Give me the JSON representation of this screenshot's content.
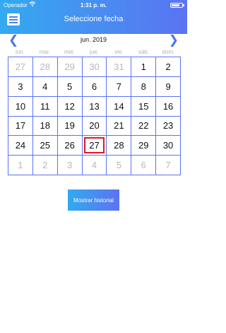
{
  "status_bar": {
    "carrier": "Operador",
    "time": "1:31 p. m."
  },
  "header": {
    "title": "Seleccione fecha",
    "menu_icon": "hamburger-menu-icon"
  },
  "calendar": {
    "month_label": "jun. 2019",
    "prev_label": "❮",
    "next_label": "❯",
    "weekdays": [
      "lun.",
      "mar.",
      "mié.",
      "jue.",
      "vie.",
      "sáb.",
      "dom."
    ],
    "selected_day": "27",
    "days": [
      {
        "d": "27",
        "cur": false
      },
      {
        "d": "28",
        "cur": false
      },
      {
        "d": "29",
        "cur": false
      },
      {
        "d": "30",
        "cur": false
      },
      {
        "d": "31",
        "cur": false
      },
      {
        "d": "1",
        "cur": true
      },
      {
        "d": "2",
        "cur": true
      },
      {
        "d": "3",
        "cur": true
      },
      {
        "d": "4",
        "cur": true
      },
      {
        "d": "5",
        "cur": true
      },
      {
        "d": "6",
        "cur": true
      },
      {
        "d": "7",
        "cur": true
      },
      {
        "d": "8",
        "cur": true
      },
      {
        "d": "9",
        "cur": true
      },
      {
        "d": "10",
        "cur": true
      },
      {
        "d": "11",
        "cur": true
      },
      {
        "d": "12",
        "cur": true
      },
      {
        "d": "13",
        "cur": true
      },
      {
        "d": "14",
        "cur": true
      },
      {
        "d": "15",
        "cur": true
      },
      {
        "d": "16",
        "cur": true
      },
      {
        "d": "17",
        "cur": true
      },
      {
        "d": "18",
        "cur": true
      },
      {
        "d": "19",
        "cur": true
      },
      {
        "d": "20",
        "cur": true
      },
      {
        "d": "21",
        "cur": true
      },
      {
        "d": "22",
        "cur": true
      },
      {
        "d": "23",
        "cur": true
      },
      {
        "d": "24",
        "cur": true
      },
      {
        "d": "25",
        "cur": true
      },
      {
        "d": "26",
        "cur": true
      },
      {
        "d": "27",
        "cur": true,
        "selected": true
      },
      {
        "d": "28",
        "cur": true
      },
      {
        "d": "29",
        "cur": true
      },
      {
        "d": "30",
        "cur": true
      },
      {
        "d": "1",
        "cur": false
      },
      {
        "d": "2",
        "cur": false
      },
      {
        "d": "3",
        "cur": false
      },
      {
        "d": "4",
        "cur": false
      },
      {
        "d": "5",
        "cur": false
      },
      {
        "d": "6",
        "cur": false
      },
      {
        "d": "7",
        "cur": false
      }
    ]
  },
  "actions": {
    "show_history_label": "Mostrar historial"
  },
  "colors": {
    "accent_start": "#33aaf0",
    "accent_end": "#5b73f3",
    "selection": "#e01920",
    "muted_text": "#b8b8b8"
  }
}
